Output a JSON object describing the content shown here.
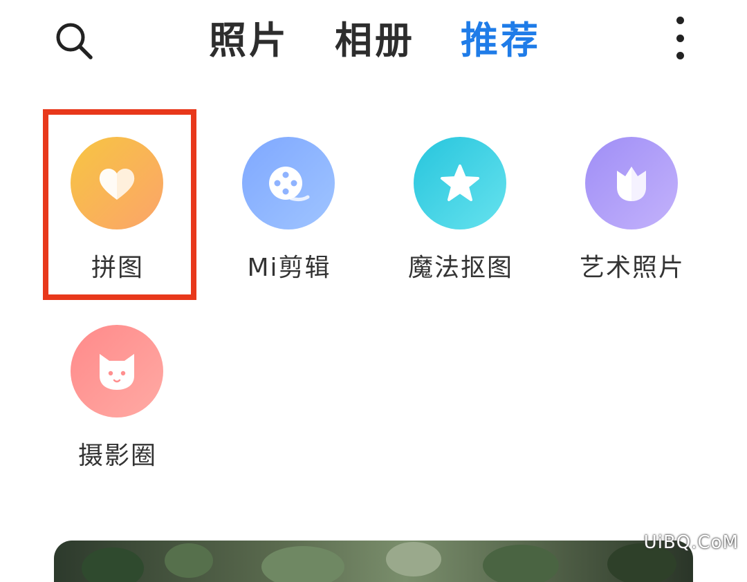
{
  "header": {
    "search_icon": "search-icon",
    "tabs": [
      {
        "label": "照片",
        "active": false
      },
      {
        "label": "相册",
        "active": false
      },
      {
        "label": "推荐",
        "active": true
      }
    ],
    "more_icon": "more-vertical-icon"
  },
  "colors": {
    "active_tab": "#1f7ce8",
    "inactive_tab": "#2d2d2d",
    "highlight_border": "#e8381b"
  },
  "tools": [
    {
      "label": "拼图",
      "icon": "heart-icon",
      "color_from": "#f7c542",
      "color_to": "#fba46a",
      "highlighted": true
    },
    {
      "label": "Mi剪辑",
      "icon": "film-reel-icon",
      "color_from": "#7fa8ff",
      "color_to": "#9fc4ff",
      "highlighted": false
    },
    {
      "label": "魔法抠图",
      "icon": "star-icon",
      "color_from": "#27c5dd",
      "color_to": "#66e2ee",
      "highlighted": false
    },
    {
      "label": "艺术照片",
      "icon": "tulip-icon",
      "color_from": "#9f8ef6",
      "color_to": "#c3b2fb",
      "highlighted": false
    },
    {
      "label": "摄影圈",
      "icon": "mi-bunny-icon",
      "color_from": "#ff8a8a",
      "color_to": "#ffaaa4",
      "highlighted": false
    }
  ],
  "watermark": "UiBQ.CoM"
}
